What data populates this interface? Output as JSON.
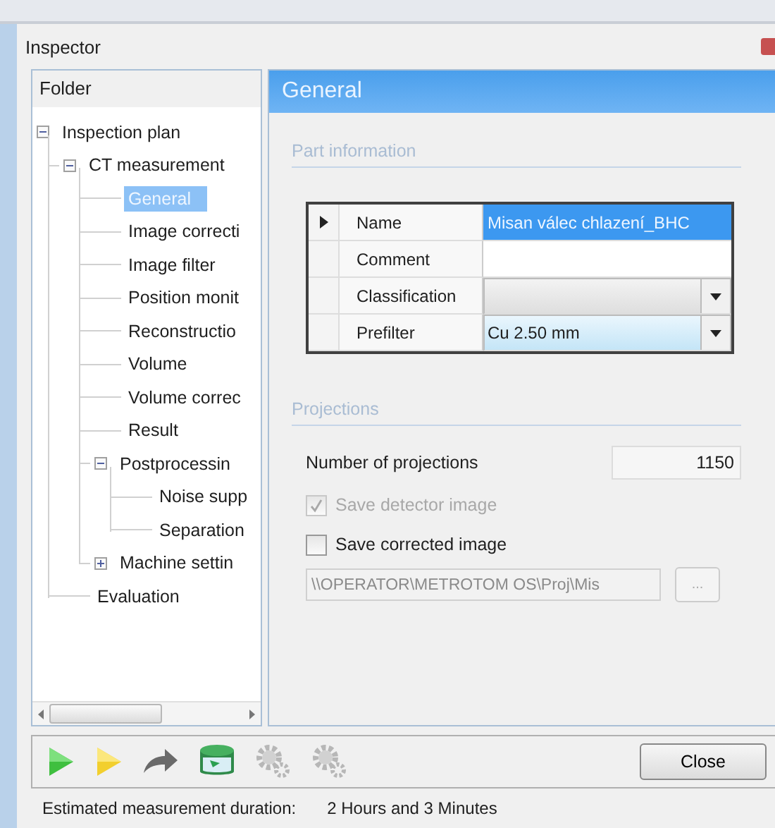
{
  "window": {
    "title": "Inspector"
  },
  "folder": {
    "title": "Folder",
    "tree": [
      {
        "label": "Inspection plan",
        "expanded": true,
        "selected": false,
        "children": [
          {
            "label": "CT measurement",
            "expanded": true,
            "selected": false,
            "children": [
              {
                "label": "General",
                "selected": true
              },
              {
                "label": "Image correcti",
                "selected": false
              },
              {
                "label": "Image filter",
                "selected": false
              },
              {
                "label": "Position monit",
                "selected": false
              },
              {
                "label": "Reconstructio",
                "selected": false
              },
              {
                "label": "Volume",
                "selected": false
              },
              {
                "label": "Volume correc",
                "selected": false
              },
              {
                "label": "Result",
                "selected": false
              },
              {
                "label": "Postprocessin",
                "expanded": true,
                "selected": false,
                "children": [
                  {
                    "label": "Noise supp",
                    "selected": false
                  },
                  {
                    "label": "Separation",
                    "selected": false
                  }
                ]
              },
              {
                "label": "Machine settin",
                "expanded": false,
                "selected": false
              }
            ]
          },
          {
            "label": "Evaluation",
            "selected": false
          }
        ]
      }
    ]
  },
  "panel": {
    "title": "General",
    "part_information": {
      "title": "Part information",
      "rows": [
        {
          "label": "Name",
          "kind": "text",
          "value": "Misan válec chlazení_BHC",
          "selected": true
        },
        {
          "label": "Comment",
          "kind": "text",
          "selected": false
        },
        {
          "label": "Classification",
          "kind": "combo",
          "selected": false
        },
        {
          "label": "Prefilter",
          "kind": "combo",
          "value": "Cu 2.50 mm",
          "selected": false
        }
      ]
    },
    "projections": {
      "title": "Projections",
      "count_label": "Number of projections",
      "count_value": "1150",
      "checkboxes": [
        {
          "label": "Save detector image",
          "checked": true,
          "disabled": true
        },
        {
          "label": "Save corrected image",
          "checked": false,
          "disabled": false
        }
      ],
      "path": "\\\\OPERATOR\\METROTOM OS\\Proj\\Mis",
      "browse": "..."
    }
  },
  "toolbar": [
    {
      "kind": "run-green",
      "disabled": false
    },
    {
      "kind": "run-yellow",
      "disabled": false
    },
    {
      "kind": "forward",
      "disabled": false
    },
    {
      "kind": "database",
      "disabled": false
    },
    {
      "kind": "gear",
      "disabled": true
    },
    {
      "kind": "gear",
      "disabled": true
    }
  ],
  "close_button": "Close",
  "status": {
    "label": "Estimated measurement duration:",
    "value": "2 Hours and 3 Minutes"
  }
}
